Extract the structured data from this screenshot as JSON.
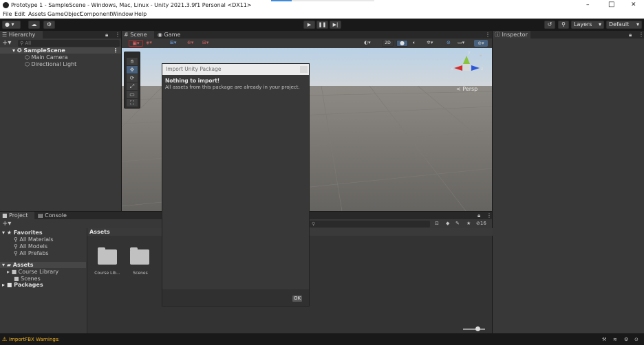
{
  "window": {
    "title": "Prototype 1 - SampleScene - Windows, Mac, Linux - Unity 2021.3.9f1 Personal <DX11>",
    "minimize": "–",
    "maximize": "□",
    "close": "✕"
  },
  "menu": [
    "File",
    "Edit",
    "Assets",
    "GameObject",
    "Component",
    "Window",
    "Help"
  ],
  "toolbar": {
    "account": "▾",
    "layers": "Layers",
    "layout": "Default"
  },
  "hierarchy": {
    "tab": "Hierarchy",
    "search_placeholder": "All",
    "scene": "SampleScene",
    "items": [
      "Main Camera",
      "Directional Light"
    ]
  },
  "scene_view": {
    "tabs": [
      "Scene",
      "Game"
    ],
    "mode_2d": "2D",
    "persp": "< Persp",
    "axis_y": "y",
    "axis_x": "x",
    "axis_z": "z"
  },
  "inspector": {
    "tab": "Inspector"
  },
  "project": {
    "tabs": [
      "Project",
      "Console"
    ],
    "favorites_label": "Favorites",
    "favorites": [
      "All Materials",
      "All Models",
      "All Prefabs"
    ],
    "assets_label": "Assets",
    "assets_children": [
      "Course Library",
      "Scenes"
    ],
    "packages_label": "Packages",
    "grid_header": "Assets",
    "grid_items": [
      "Course Lib...",
      "Scenes"
    ],
    "hidden_count": "16"
  },
  "dialog": {
    "title": "Import Unity Package",
    "heading": "Nothing to import!",
    "message": "All assets from this package are already in your project.",
    "ok": "OK"
  },
  "statusbar": {
    "message": "ImportFBX Warnings:"
  }
}
